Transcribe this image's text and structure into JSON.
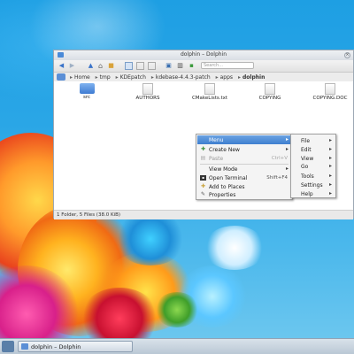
{
  "window": {
    "title": "dolphin – Dolphin",
    "search_placeholder": "Search..."
  },
  "breadcrumb": [
    "Home",
    "tmp",
    "KDEpatch",
    "kdebase-4.4.3-patch",
    "apps",
    "dolphin"
  ],
  "files": [
    {
      "name": "src",
      "kind": "folder"
    },
    {
      "name": "AUTHORS",
      "kind": "file"
    },
    {
      "name": "CMakeLists.txt",
      "kind": "file"
    },
    {
      "name": "COPYING",
      "kind": "file"
    },
    {
      "name": "COPYING.DOC",
      "kind": "file"
    }
  ],
  "status": "1 Folder, 5 Files (38.0 KiB)",
  "context_menu": {
    "items": [
      {
        "label": "Menu",
        "icon": "",
        "shortcut": "",
        "submenu": true,
        "highlighted": true,
        "disabled": false
      },
      {
        "label": "Create New",
        "icon": "create-new-icon",
        "shortcut": "",
        "submenu": true,
        "highlighted": false,
        "disabled": false
      },
      {
        "label": "Paste",
        "icon": "paste-icon",
        "shortcut": "Ctrl+V",
        "submenu": false,
        "highlighted": false,
        "disabled": true
      },
      {
        "label": "View Mode",
        "icon": "",
        "shortcut": "",
        "submenu": true,
        "highlighted": false,
        "disabled": false
      },
      {
        "label": "Open Terminal",
        "icon": "terminal-icon",
        "shortcut": "Shift+F4",
        "submenu": false,
        "highlighted": false,
        "disabled": false
      },
      {
        "label": "Add to Places",
        "icon": "add-places-icon",
        "shortcut": "",
        "submenu": false,
        "highlighted": false,
        "disabled": false
      },
      {
        "label": "Properties",
        "icon": "properties-icon",
        "shortcut": "",
        "submenu": false,
        "highlighted": false,
        "disabled": false
      }
    ]
  },
  "submenu": {
    "items": [
      "File",
      "Edit",
      "View",
      "Go",
      "Tools",
      "Settings",
      "Help"
    ]
  },
  "taskbar": {
    "task_label": "dolphin – Dolphin"
  }
}
